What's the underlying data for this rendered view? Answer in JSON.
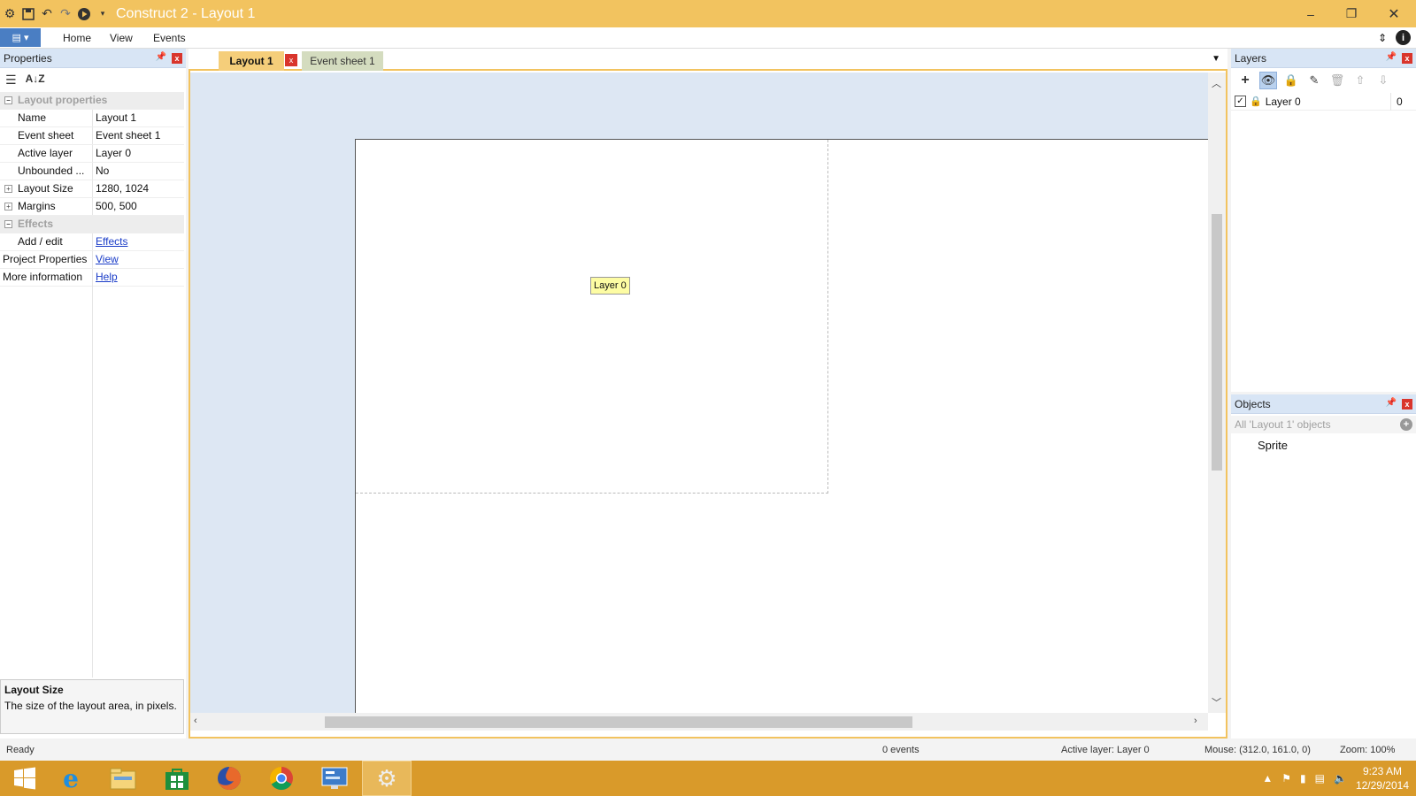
{
  "window": {
    "title": "Construct 2 - Layout 1",
    "controls": {
      "minimize": "–",
      "restore": "❐",
      "close": "✕"
    }
  },
  "ribbon": {
    "tabs": [
      "Home",
      "View",
      "Events"
    ]
  },
  "properties": {
    "title": "Properties",
    "rows": [
      {
        "type": "category",
        "name": "Layout properties"
      },
      {
        "type": "prop",
        "name": "Name",
        "value": "Layout 1"
      },
      {
        "type": "prop",
        "name": "Event sheet",
        "value": "Event sheet 1"
      },
      {
        "type": "prop",
        "name": "Active layer",
        "value": "Layer 0"
      },
      {
        "type": "prop",
        "name": "Unbounded ...",
        "value": "No"
      },
      {
        "type": "prop",
        "name": "Layout Size",
        "value": "1280, 1024",
        "expandable": true
      },
      {
        "type": "prop",
        "name": "Margins",
        "value": "500, 500",
        "expandable": true
      },
      {
        "type": "category",
        "name": "Effects"
      },
      {
        "type": "link",
        "name": "Add / edit",
        "value": "Effects"
      },
      {
        "type": "toplink",
        "name": "Project Properties",
        "value": "View"
      },
      {
        "type": "toplink",
        "name": "More information",
        "value": "Help"
      }
    ],
    "help": {
      "title": "Layout Size",
      "description": "The size of the layout area, in pixels."
    }
  },
  "document": {
    "tabs": [
      {
        "label": "Layout 1",
        "active": true
      },
      {
        "label": "Event sheet 1",
        "active": false
      }
    ],
    "layer_label": "Layer 0"
  },
  "layers": {
    "title": "Layers",
    "items": [
      {
        "name": "Layer 0",
        "visible": true,
        "index": "0"
      }
    ]
  },
  "objects": {
    "title": "Objects",
    "filter": "All 'Layout 1' objects",
    "items": [
      "Sprite"
    ]
  },
  "status": {
    "state": "Ready",
    "events": "0 events",
    "active_layer": "Active layer: Layer 0",
    "mouse": "Mouse: (312.0, 161.0, 0)",
    "zoom": "Zoom: 100%"
  },
  "clock": {
    "time": "9:23 AM",
    "date": "12/29/2014"
  }
}
